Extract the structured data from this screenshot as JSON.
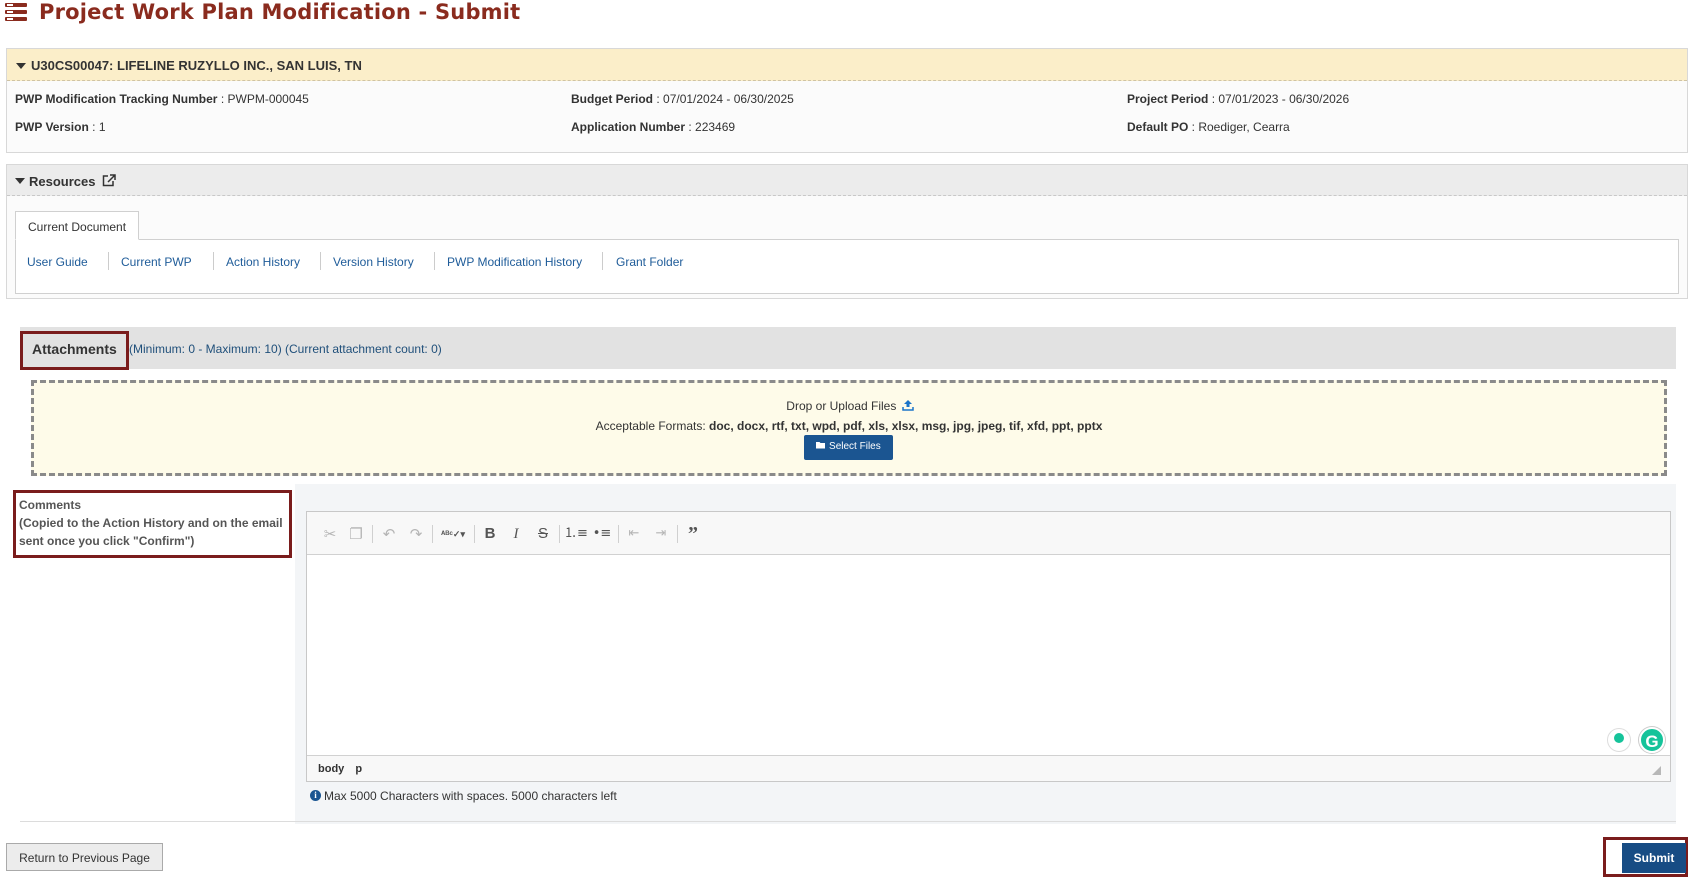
{
  "page": {
    "title": "Project Work Plan Modification - Submit"
  },
  "grant": {
    "header": "U30CS00047: LIFELINE RUZYLLO INC., SAN LUIS, TN",
    "fields": {
      "tracking_label": "PWP Modification Tracking Number",
      "tracking_value": " : PWPM-000045",
      "budget_label": "Budget Period",
      "budget_value": " : 07/01/2024 - 06/30/2025",
      "project_label": "Project Period",
      "project_value": " : 07/01/2023 - 06/30/2026",
      "version_label": "PWP Version",
      "version_value": " : 1",
      "application_label": "Application Number",
      "application_value": " : 223469",
      "po_label": "Default PO",
      "po_value": " : Roediger, Cearra"
    }
  },
  "resources": {
    "header": "Resources",
    "tab": "Current Document",
    "links": [
      "User Guide",
      "Current PWP",
      "Action History",
      "Version History",
      "PWP Modification History",
      "Grant Folder"
    ]
  },
  "attachments": {
    "title": "Attachments",
    "info": "(Minimum: 0 - Maximum: 10) (Current attachment count: 0)",
    "drop_text": "Drop or Upload Files",
    "formats_label": "Acceptable Formats: ",
    "formats": "doc, docx, rtf, txt, wpd, pdf, xls, xlsx, msg, jpg, jpeg, tif, xfd, ppt, pptx",
    "select_button": "Select Files"
  },
  "comments": {
    "label": "Comments",
    "note": "(Copied to the Action History and on the email sent once you click \"Confirm\")",
    "status_body": "body",
    "status_p": "p",
    "char_info": "Max 5000 Characters with spaces. 5000 characters left",
    "grammarly_letter": "G"
  },
  "toolbar_icons": [
    "cut-icon",
    "copy-icon",
    "undo-icon",
    "redo-icon",
    "spellcheck-icon",
    "bold-icon",
    "italic-icon",
    "strikethrough-icon",
    "numbered-list-icon",
    "bulleted-list-icon",
    "outdent-icon",
    "indent-icon",
    "blockquote-icon"
  ],
  "footer": {
    "return_button": "Return to Previous Page",
    "submit_button": "Submit"
  },
  "colors": {
    "title": "#8a2b1e",
    "grant_header_bg": "#fbeec9",
    "primary_button": "#174c84",
    "highlight_box": "#7a1c1c"
  }
}
